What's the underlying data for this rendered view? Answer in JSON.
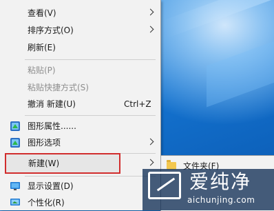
{
  "menu": {
    "items": [
      {
        "label": "查看(V)"
      },
      {
        "label": "排序方式(O)"
      },
      {
        "label": "刷新(E)"
      },
      {
        "label": "粘贴(P)"
      },
      {
        "label": "粘贴快捷方式(S)"
      },
      {
        "label": "撤消 新建(U)",
        "shortcut": "Ctrl+Z"
      },
      {
        "label": "图形属性......"
      },
      {
        "label": "图形选项"
      },
      {
        "label": "新建(W)"
      },
      {
        "label": "显示设置(D)"
      },
      {
        "label": "个性化(R)"
      }
    ]
  },
  "submenu": {
    "items": [
      {
        "label": "文件夹(F)",
        "icon": "folder-icon"
      }
    ]
  },
  "watermark": {
    "title": "爱纯净",
    "url": "aichunjing.com"
  },
  "colors": {
    "menu_bg": "#f2f2f2",
    "highlight_border": "#d12c2c",
    "desktop_blue": "#1572c9",
    "disabled_text": "#8e8e8e"
  }
}
